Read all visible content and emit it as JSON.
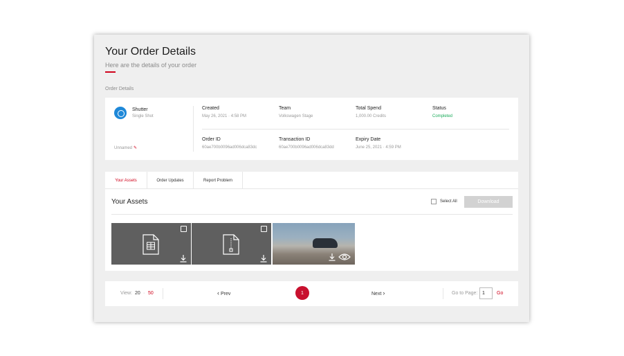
{
  "header": {
    "title": "Your Order Details",
    "subtitle": "Here are the details of your order",
    "accent": "#d0021b"
  },
  "order_details": {
    "section_label": "Order Details",
    "product": {
      "name": "Shutter",
      "type": "Single Shot",
      "icon": "shutter-icon",
      "icon_color": "#1e88d8"
    },
    "unnamed_label": "Unnamed",
    "fields": {
      "created": {
        "label": "Created",
        "value": "May 26, 2021 · 4:58 PM"
      },
      "team": {
        "label": "Team",
        "value": "Volkswagen Stage"
      },
      "total_spend": {
        "label": "Total Spend",
        "value": "1,000.00 Credits"
      },
      "status": {
        "label": "Status",
        "value": "Completed",
        "color": "#1aab5a"
      },
      "order_id": {
        "label": "Order ID",
        "value": "60ae700b0096ad006dca83dc"
      },
      "transaction_id": {
        "label": "Transaction ID",
        "value": "60ae700b0096ad006dca83dd"
      },
      "expiry_date": {
        "label": "Expiry Date",
        "value": "June 25, 2021 · 4:59 PM"
      }
    }
  },
  "tabs": [
    {
      "label": "Your Assets",
      "active": true
    },
    {
      "label": "Order Updates",
      "active": false
    },
    {
      "label": "Report Problem",
      "active": false
    }
  ],
  "assets": {
    "title": "Your Assets",
    "select_all_label": "Select All",
    "download_label": "Download",
    "items": [
      {
        "kind": "spreadsheet-file",
        "icon": "spreadsheet-file-icon"
      },
      {
        "kind": "zip-file",
        "icon": "zip-file-icon"
      },
      {
        "kind": "photo",
        "icon": "photo-thumbnail"
      }
    ]
  },
  "pagination": {
    "view_label": "View:",
    "view_options": [
      "20",
      "50"
    ],
    "view_separator": "·",
    "prev_label": "Prev",
    "current_page": "1",
    "next_label": "Next",
    "goto_label": "Go to Page:",
    "goto_value": "1",
    "go_label": "Go"
  }
}
